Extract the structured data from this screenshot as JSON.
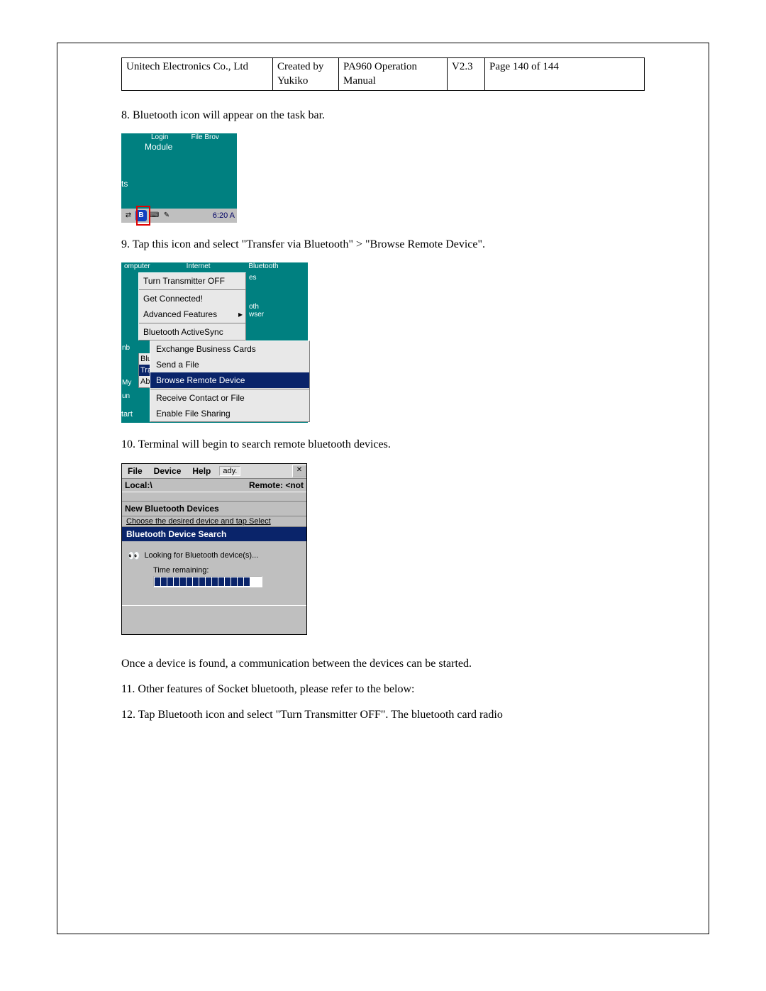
{
  "header": {
    "company": "Unitech Electronics Co., Ltd",
    "created": "Created by Yukiko",
    "doc": "PA960 Operation Manual",
    "version": "V2.3",
    "page": "Page 140 of 144"
  },
  "step8": "8. Bluetooth icon will appear on the task bar.",
  "shot1": {
    "top_label1": "Login",
    "top_label2": "File Brov",
    "module": "Module",
    "ts": "ts",
    "clock": "6:20 A"
  },
  "step9": "9. Tap this icon and select \"Transfer via Bluetooth\" > \"Browse Remote Device\".",
  "shot2": {
    "top1": "omputer",
    "top2": "Internet",
    "top3": "Bluetooth",
    "right_es": "es",
    "right_oth": "oth",
    "right_wser": "wser",
    "menu": {
      "m1": "Turn Transmitter OFF",
      "m2": "Get Connected!",
      "m3": "Advanced Features",
      "m4": "Bluetooth ActiveSync"
    },
    "li_nb": "nb",
    "li_my": "My",
    "li_un": "un",
    "lab_blu": "Blu",
    "lab_tra": "Tra",
    "lab_ab": "Ab",
    "start": "tart",
    "sub": {
      "s1": "Exchange Business Cards",
      "s2": "Send a File",
      "s3": "Browse Remote Device",
      "s4": "Receive Contact or File",
      "s5": "Enable File Sharing"
    }
  },
  "step10": "10. Terminal will begin to search remote bluetooth devices.",
  "shot3": {
    "menu_file": "File",
    "menu_device": "Device",
    "menu_help": "Help",
    "ready": "ady.",
    "local": "Local:\\",
    "remote": "Remote: <not",
    "subhead": "New Bluetooth Devices",
    "choose": "Choose the desired device and tap Select",
    "dlg_title": "Bluetooth Device Search",
    "looking": "Looking for Bluetooth device(s)...",
    "time_remaining": "Time remaining:"
  },
  "para_once": "Once a device is found, a communication between the devices can be started.",
  "step11": "11. Other features of Socket bluetooth, please refer to the below:",
  "step12": "12. Tap Bluetooth icon and select \"Turn Transmitter OFF\". The bluetooth card radio"
}
